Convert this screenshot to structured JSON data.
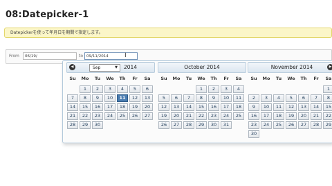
{
  "page": {
    "title": "08:Datepicker-1",
    "notice": "Datepickerを使って年月日を期間で指定します。"
  },
  "range": {
    "from_label": "From",
    "from_value": "06/19/",
    "to_label": "to",
    "to_value": "09/11/2014"
  },
  "calendar": {
    "weekdays": [
      "Su",
      "Mo",
      "Tu",
      "We",
      "Th",
      "Fr",
      "Sa"
    ],
    "months": [
      {
        "select_value": "Sep",
        "year": "2014",
        "title": "",
        "has_select": true,
        "first_weekday": 1,
        "days": 30,
        "highlight": 11
      },
      {
        "select_value": "",
        "year": "",
        "title": "October 2014",
        "has_select": false,
        "first_weekday": 3,
        "days": 31,
        "highlight": null
      },
      {
        "select_value": "",
        "year": "",
        "title": "November 2014",
        "has_select": false,
        "first_weekday": 6,
        "days": 30,
        "highlight": null
      }
    ],
    "prev_icon": "prev-arrow-icon",
    "next_icon": "next-arrow-icon"
  },
  "colors": {
    "notice_bg": "#fbf6c8",
    "header_border": "#b9cddd",
    "today_bg": "#4a7cb0"
  }
}
